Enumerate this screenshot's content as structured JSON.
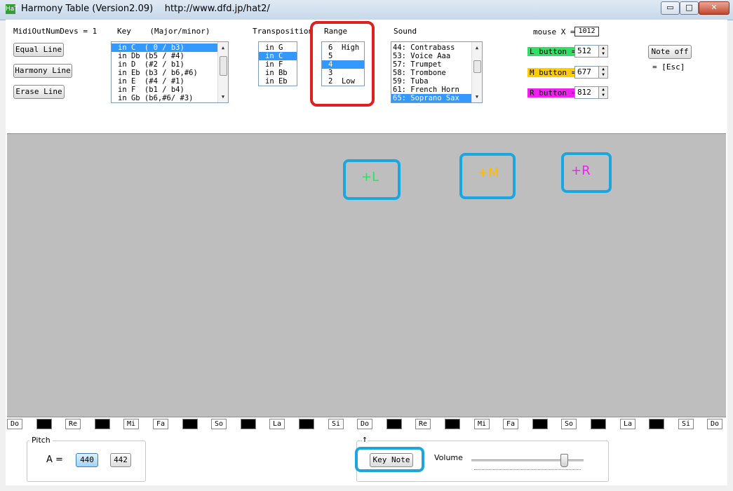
{
  "window": {
    "title": "Harmony Table (Version2.09)    http://www.dfd.jp/hat2/",
    "icon_text": "HaT",
    "minimize": "▭",
    "maximize": "□",
    "close": "✕"
  },
  "top": {
    "midi_label": "MidiOutNumDevs = 1",
    "buttons": [
      "Equal Line",
      "Harmony Line",
      "Erase Line"
    ],
    "key_header": "Key    (Major/minor)",
    "key_items": [
      "in C  ( 0 / b3)",
      "in Db (b5 / #4)",
      "in D  (#2 / b1)",
      "in Eb (b3 / b6,#6)",
      "in E  (#4 / #1)",
      "in F  (b1 / b4)",
      "in Gb (b6,#6/ #3)"
    ],
    "transposition_header": "Transposition",
    "transposition_items": [
      "in G",
      "in C",
      "in F",
      "in Bb",
      "in Eb"
    ],
    "range_header": "Range",
    "range_items": [
      "6  High",
      "5",
      "4",
      "3",
      "2  Low"
    ],
    "sound_header": "Sound",
    "sound_items": [
      "44: Contrabass",
      "53: Voice Aaa",
      "57: Trumpet",
      "58: Trombone",
      "59: Tuba",
      "61: French Horn",
      "65: Soprano Sax"
    ],
    "mouse_x_label": "mouse X =",
    "mouse_x_value": "1012",
    "l_button_label": "L button =",
    "l_button_value": "512",
    "m_button_label": "M button =",
    "m_button_value": "677",
    "r_button_label": "R button =",
    "r_button_value": "812",
    "note_off": "Note off",
    "esc_hint": "= [Esc]"
  },
  "canvas": {
    "markers": [
      "+L",
      "+M",
      "+R"
    ]
  },
  "keyboard": [
    "Do",
    "",
    "Re",
    "",
    "Mi",
    "Fa",
    "",
    "So",
    "",
    "La",
    "",
    "Si",
    "Do",
    "",
    "Re",
    "",
    "Mi",
    "Fa",
    "",
    "So",
    "",
    "La",
    "",
    "Si",
    "Do"
  ],
  "bottom": {
    "pitch_group": "Pitch",
    "a_equals": "A =",
    "pitch_options": [
      "440",
      "442"
    ],
    "up_arrow": "↑",
    "key_note": "Key Note",
    "volume_label": "Volume",
    "volume_level": 0.82
  },
  "colors": {
    "l_button": "#33dd66",
    "m_button": "#ffcc00",
    "r_button": "#ee22ee",
    "plus_l": "#33dd66",
    "plus_m": "#ffbb00",
    "plus_r": "#ee22ee",
    "highlight_red": "#e02020",
    "highlight_blue": "#1aa7e0"
  }
}
